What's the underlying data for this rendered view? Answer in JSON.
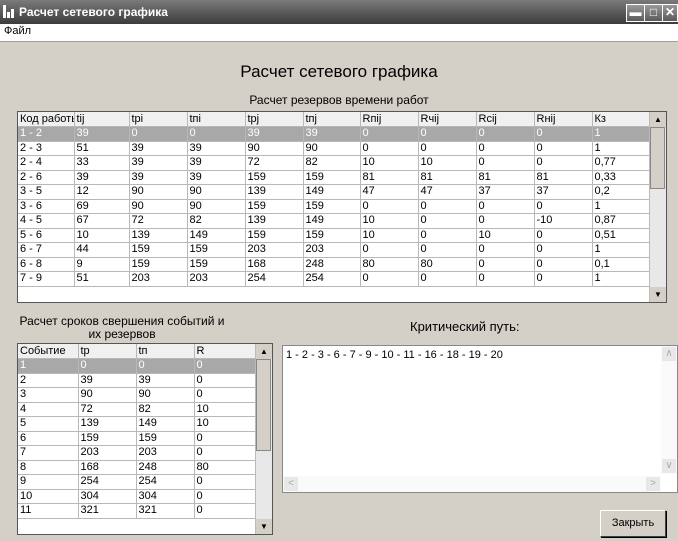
{
  "window": {
    "title": "Расчет сетевого графика"
  },
  "menu": {
    "file": "Файл"
  },
  "heading": "Расчет сетевого графика",
  "works": {
    "caption": "Расчет резервов времени работ",
    "columns": [
      "Код работы",
      "tij",
      "tpi",
      "tпi",
      "tpj",
      "tпj",
      "Rпij",
      "Rчij",
      "Rcij",
      "Rнij",
      "Кз"
    ],
    "rows": [
      [
        "1 - 2",
        "39",
        "0",
        "0",
        "39",
        "39",
        "0",
        "0",
        "0",
        "0",
        "1"
      ],
      [
        "2 - 3",
        "51",
        "39",
        "39",
        "90",
        "90",
        "0",
        "0",
        "0",
        "0",
        "1"
      ],
      [
        "2 - 4",
        "33",
        "39",
        "39",
        "72",
        "82",
        "10",
        "10",
        "0",
        "0",
        "0,77"
      ],
      [
        "2 - 6",
        "39",
        "39",
        "39",
        "159",
        "159",
        "81",
        "81",
        "81",
        "81",
        "0,33"
      ],
      [
        "3 - 5",
        "12",
        "90",
        "90",
        "139",
        "149",
        "47",
        "47",
        "37",
        "37",
        "0,2"
      ],
      [
        "3 - 6",
        "69",
        "90",
        "90",
        "159",
        "159",
        "0",
        "0",
        "0",
        "0",
        "1"
      ],
      [
        "4 - 5",
        "67",
        "72",
        "82",
        "139",
        "149",
        "10",
        "0",
        "0",
        "-10",
        "0,87"
      ],
      [
        "5 - 6",
        "10",
        "139",
        "149",
        "159",
        "159",
        "10",
        "0",
        "10",
        "0",
        "0,51"
      ],
      [
        "6 - 7",
        "44",
        "159",
        "159",
        "203",
        "203",
        "0",
        "0",
        "0",
        "0",
        "1"
      ],
      [
        "6 - 8",
        "9",
        "159",
        "159",
        "168",
        "248",
        "80",
        "80",
        "0",
        "0",
        "0,1"
      ],
      [
        "7 - 9",
        "51",
        "203",
        "203",
        "254",
        "254",
        "0",
        "0",
        "0",
        "0",
        "1"
      ]
    ]
  },
  "events": {
    "caption": "Расчет сроков свершения событий и их резервов",
    "columns": [
      "Событие",
      "tp",
      "tп",
      "R"
    ],
    "rows": [
      [
        "1",
        "0",
        "0",
        "0"
      ],
      [
        "2",
        "39",
        "39",
        "0"
      ],
      [
        "3",
        "90",
        "90",
        "0"
      ],
      [
        "4",
        "72",
        "82",
        "10"
      ],
      [
        "5",
        "139",
        "149",
        "10"
      ],
      [
        "6",
        "159",
        "159",
        "0"
      ],
      [
        "7",
        "203",
        "203",
        "0"
      ],
      [
        "8",
        "168",
        "248",
        "80"
      ],
      [
        "9",
        "254",
        "254",
        "0"
      ],
      [
        "10",
        "304",
        "304",
        "0"
      ],
      [
        "11",
        "321",
        "321",
        "0"
      ]
    ]
  },
  "critical": {
    "label": "Критический путь:",
    "path": "1 - 2 - 3 - 6 - 7 - 9 - 10 - 11 - 16 - 18 - 19 - 20"
  },
  "close_label": "Закрыть"
}
